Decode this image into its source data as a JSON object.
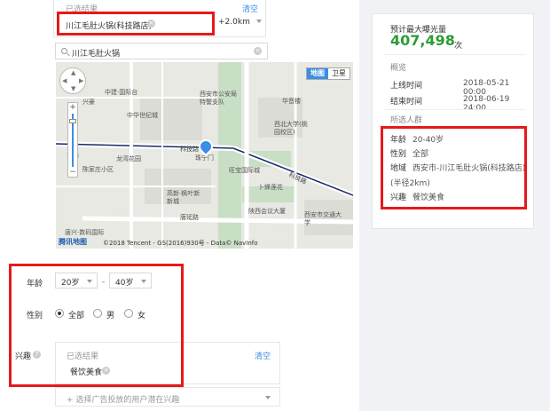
{
  "selection": {
    "title": "已选结果",
    "clear": "清空",
    "store": "川江毛肚火锅(科技路店)",
    "radius": "+2.0km"
  },
  "search": {
    "value": "川江毛肚火锅"
  },
  "map": {
    "switch_map": "地图",
    "switch_satellite": "卫星",
    "logo": "腾讯地图",
    "copyright": "©2018 Tencent - GS(2016)930号 - Data© NavInfo",
    "labels": {
      "zhongjian": "中建·国际台",
      "xinghao": "兴豪",
      "zhonghua": "中华世纪城",
      "xianjiaotong": "西安市公安局特警支队",
      "huayin": "华音楼",
      "xidaxue": "西北大学(桃园校区)",
      "kejilu": "科技路",
      "kjl2": "科技路",
      "fengshan": "丰山",
      "xingyuan": "兴元",
      "chenjiazhuang": "陈家庄小区",
      "longyuan": "龙湾花园",
      "zhusheng": "珠宁门",
      "jinsheng": "旺宝国际城",
      "xiyang": "西·枫叶",
      "gaoxin": "高新·枫叶新新城",
      "tangyan": "唐延路",
      "tangyan2": "唐延路",
      "shaanxi": "陕西会议大厦",
      "xingfu": "卜蜂莲花",
      "tangxing": "唐兴·数码国际",
      "xianjiao": "西安市交通大学",
      "jiahe": "嘉禾"
    }
  },
  "filters": {
    "age_label": "年龄",
    "age_from": "20岁",
    "age_dash": "-",
    "age_to": "40岁",
    "gender_label": "性别",
    "gender_options": [
      "全部",
      "男",
      "女"
    ],
    "interest_label": "兴趣",
    "interest_help": "?",
    "interest_box_title": "已选结果",
    "interest_box_clear": "清空",
    "interest_tag": "餐饮美食",
    "ad_select_placeholder": "+ 选择广告投放的用户潜在兴趣"
  },
  "summary": {
    "reach_label": "预计最大曝光量",
    "reach_value": "407,498",
    "reach_unit": "次",
    "overview": "概览",
    "start_label": "上线时间",
    "start_value": "2018-05-21 00:00",
    "end_label": "结束时间",
    "end_value": "2018-06-19 24:00",
    "audience_title": "所选人群",
    "age_label": "年龄",
    "age_value": "20-40岁",
    "gender_label": "性别",
    "gender_value": "全部",
    "region_label": "地域",
    "region_value": "西安市-川江毛肚火锅(科技路店)",
    "region_radius": "(半径2km)",
    "interest_label": "兴趣",
    "interest_value": "餐饮美食"
  }
}
